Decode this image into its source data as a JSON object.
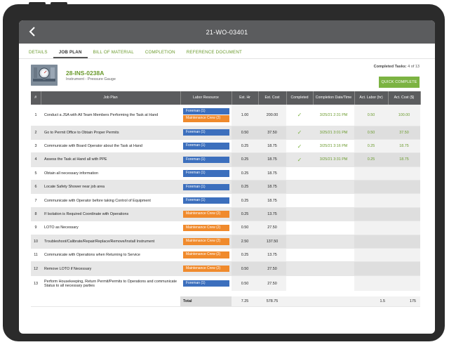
{
  "window": {
    "title": "21-WO-03401"
  },
  "tabs": [
    "DETAILS",
    "JOB PLAN",
    "BILL OF MATERIAL",
    "COMPLETION",
    "REFERENCE DOCUMENT"
  ],
  "active_tab": "JOB PLAN",
  "asset": {
    "tag": "28-INS-0238A",
    "description": "Instrument - Pressure Gauge"
  },
  "completed": {
    "label": "Completed Tasks:",
    "value": "4 of 13"
  },
  "quick_complete_label": "QUICK COMPLETE",
  "columns": [
    "#",
    "Job Plan",
    "Labor Resource",
    "Est. Hr",
    "Est. Cost",
    "Completed",
    "Completion Date/Time",
    "Act. Labor (hr)",
    "Act. Cost ($)"
  ],
  "rows": [
    {
      "n": "1",
      "plan": "Conduct a JSA with All Team Members Performing the Task at Hand",
      "labor": [
        {
          "text": "Foreman (1)",
          "color": "blue"
        },
        {
          "text": "Maintenance Crew (2)",
          "color": "orange"
        }
      ],
      "est_hr": "1.00",
      "est_cost": "200.00",
      "completed": true,
      "date": "3/25/21 2:31 PM",
      "act_labor": "0.50",
      "act_cost": "100.00"
    },
    {
      "n": "2",
      "plan": "Go to Permit Office to Obtain Proper Permits",
      "labor": [
        {
          "text": "Foreman (1)",
          "color": "blue"
        }
      ],
      "est_hr": "0.50",
      "est_cost": "37.50",
      "completed": true,
      "date": "3/25/21 3:01 PM",
      "act_labor": "0.50",
      "act_cost": "37.50"
    },
    {
      "n": "3",
      "plan": "Communicate with Board Operator about the Task at Hand",
      "labor": [
        {
          "text": "Foreman (1)",
          "color": "blue"
        }
      ],
      "est_hr": "0.25",
      "est_cost": "18.75",
      "completed": true,
      "date": "3/25/21 3:16 PM",
      "act_labor": "0.25",
      "act_cost": "18.75"
    },
    {
      "n": "4",
      "plan": "Assess the Task at Hand all with PPE",
      "labor": [
        {
          "text": "Foreman (1)",
          "color": "blue"
        }
      ],
      "est_hr": "0.25",
      "est_cost": "18.75",
      "completed": true,
      "date": "3/25/21 3:31 PM",
      "act_labor": "0.25",
      "act_cost": "18.75"
    },
    {
      "n": "5",
      "plan": "Obtain all necessary information",
      "labor": [
        {
          "text": "Foreman (1)",
          "color": "blue"
        }
      ],
      "est_hr": "0.25",
      "est_cost": "18.75",
      "completed": false,
      "date": "",
      "act_labor": "",
      "act_cost": ""
    },
    {
      "n": "6",
      "plan": "Locate Safety Shower near job area",
      "labor": [
        {
          "text": "Foreman (1)",
          "color": "blue"
        }
      ],
      "est_hr": "0.25",
      "est_cost": "18.75",
      "completed": false,
      "date": "",
      "act_labor": "",
      "act_cost": ""
    },
    {
      "n": "7",
      "plan": "Communicate with Operator before taking Control of Equipment",
      "labor": [
        {
          "text": "Foreman (1)",
          "color": "blue"
        }
      ],
      "est_hr": "0.25",
      "est_cost": "18.75",
      "completed": false,
      "date": "",
      "act_labor": "",
      "act_cost": ""
    },
    {
      "n": "8",
      "plan": "If Isolation is Required Coordinate with Operations",
      "labor": [
        {
          "text": "Maintenance Crew (2)",
          "color": "orange"
        }
      ],
      "est_hr": "0.25",
      "est_cost": "13.75",
      "completed": false,
      "date": "",
      "act_labor": "",
      "act_cost": ""
    },
    {
      "n": "9",
      "plan": "LOTO as Necessary",
      "labor": [
        {
          "text": "Maintenance Crew (2)",
          "color": "orange"
        }
      ],
      "est_hr": "0.50",
      "est_cost": "27.50",
      "completed": false,
      "date": "",
      "act_labor": "",
      "act_cost": ""
    },
    {
      "n": "10",
      "plan": "Troubleshoot/Calibrate/Repair/Replace/Remove/Install Instrument",
      "labor": [
        {
          "text": "Maintenance Crew (2)",
          "color": "orange"
        }
      ],
      "est_hr": "2.50",
      "est_cost": "137.50",
      "completed": false,
      "date": "",
      "act_labor": "",
      "act_cost": ""
    },
    {
      "n": "11",
      "plan": "Communicate with Operations when Returning to Service",
      "labor": [
        {
          "text": "Maintenance Crew (2)",
          "color": "orange"
        }
      ],
      "est_hr": "0.25",
      "est_cost": "13.75",
      "completed": false,
      "date": "",
      "act_labor": "",
      "act_cost": ""
    },
    {
      "n": "12",
      "plan": "Remove LOTO if Necessary",
      "labor": [
        {
          "text": "Maintenance Crew (2)",
          "color": "orange"
        }
      ],
      "est_hr": "0.50",
      "est_cost": "27.50",
      "completed": false,
      "date": "",
      "act_labor": "",
      "act_cost": ""
    },
    {
      "n": "13",
      "plan": "Perform Housekeeping, Return Permit/Permits to Operations and communicate Status to all necessary parties",
      "labor": [
        {
          "text": "Foreman (1)",
          "color": "blue"
        }
      ],
      "est_hr": "0.50",
      "est_cost": "27.50",
      "completed": false,
      "date": "",
      "act_labor": "",
      "act_cost": ""
    }
  ],
  "totals": {
    "label": "Total",
    "est_hr": "7.25",
    "est_cost": "578.75",
    "act_labor": "1.5",
    "act_cost": "175"
  },
  "colors": {
    "accent_green": "#7cb342",
    "header_gray": "#5b5c5e",
    "foreman_blue": "#3c6fbd",
    "crew_orange": "#f08a2c"
  }
}
